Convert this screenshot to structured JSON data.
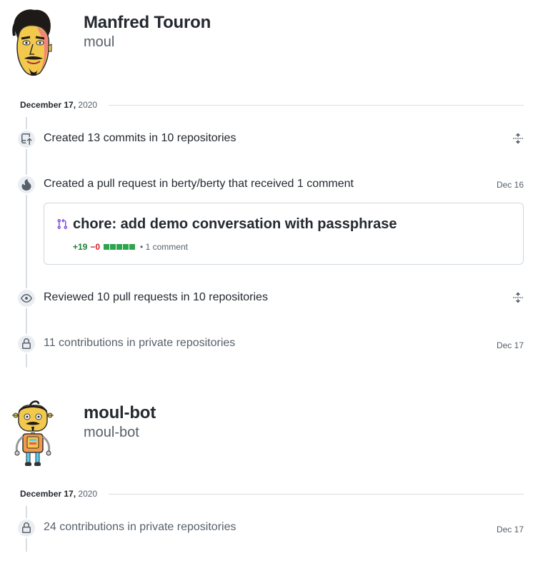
{
  "profiles": [
    {
      "display_name": "Manfred Touron",
      "username": "moul",
      "date": {
        "day": "December 17,",
        "year": "2020"
      },
      "events": [
        {
          "icon": "repo-push-icon",
          "text": "Created 13 commits in 10 repositories",
          "action": "expand"
        },
        {
          "icon": "pull-request-flame-icon",
          "text": "Created a pull request in berty/berty that received 1 comment",
          "date": "Dec 16"
        },
        {
          "icon": "eye-icon",
          "text": "Reviewed 10 pull requests in 10 repositories",
          "action": "expand"
        },
        {
          "icon": "lock-icon",
          "text": "11 contributions in private repositories",
          "date": "Dec 17"
        }
      ],
      "pull_request": {
        "title": "chore: add demo conversation with passphrase",
        "additions": "+19",
        "deletions": "−0",
        "diffstat_blocks": 5,
        "comments": "1 comment"
      }
    },
    {
      "display_name": "moul-bot",
      "username": "moul-bot",
      "date": {
        "day": "December 17,",
        "year": "2020"
      },
      "events": [
        {
          "icon": "lock-icon",
          "text": "24 contributions in private repositories",
          "date": "Dec 17"
        }
      ]
    }
  ],
  "colors": {
    "additions": "#1a7f37",
    "deletions": "#cf222e",
    "pr_icon": "#8250df",
    "diffstat": "#2da44e"
  }
}
